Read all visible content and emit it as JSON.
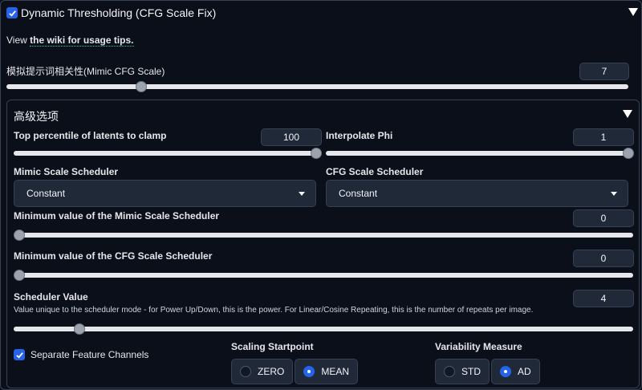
{
  "header": {
    "title": "Dynamic Thresholding (CFG Scale Fix)",
    "enabled": true
  },
  "wiki": {
    "prefix": "View ",
    "link_text": "the wiki for usage tips."
  },
  "mimic": {
    "label": "模拟提示词相关性(Mimic CFG Scale)",
    "value": "7",
    "fraction": 0.2
  },
  "advanced": {
    "title": "高级选项",
    "top_percentile": {
      "label": "Top percentile of latents to clamp",
      "value": "100",
      "fraction": 1.0
    },
    "interpolate_phi": {
      "label": "Interpolate Phi",
      "value": "1",
      "fraction": 1.0
    },
    "mimic_scheduler": {
      "label": "Mimic Scale Scheduler",
      "selected": "Constant"
    },
    "cfg_scheduler": {
      "label": "CFG Scale Scheduler",
      "selected": "Constant"
    },
    "min_mimic": {
      "label": "Minimum value of the Mimic Scale Scheduler",
      "value": "0",
      "fraction": 0.0
    },
    "min_cfg": {
      "label": "Minimum value of the CFG Scale Scheduler",
      "value": "0",
      "fraction": 0.0
    },
    "scheduler_value": {
      "label": "Scheduler Value",
      "info": "Value unique to the scheduler mode - for Power Up/Down, this is the power. For Linear/Cosine Repeating, this is the number of repeats per image.",
      "value": "4",
      "fraction": 0.11
    },
    "separate_channels": {
      "label": "Separate Feature Channels",
      "checked": true
    },
    "scaling_startpoint": {
      "label": "Scaling Startpoint",
      "options": [
        "ZERO",
        "MEAN"
      ],
      "selected": "MEAN"
    },
    "variability_measure": {
      "label": "Variability Measure",
      "options": [
        "STD",
        "AD"
      ],
      "selected": "AD"
    }
  },
  "colors": {
    "accent": "#2563eb",
    "background": "#0b0f19",
    "input": "#1f2937"
  }
}
